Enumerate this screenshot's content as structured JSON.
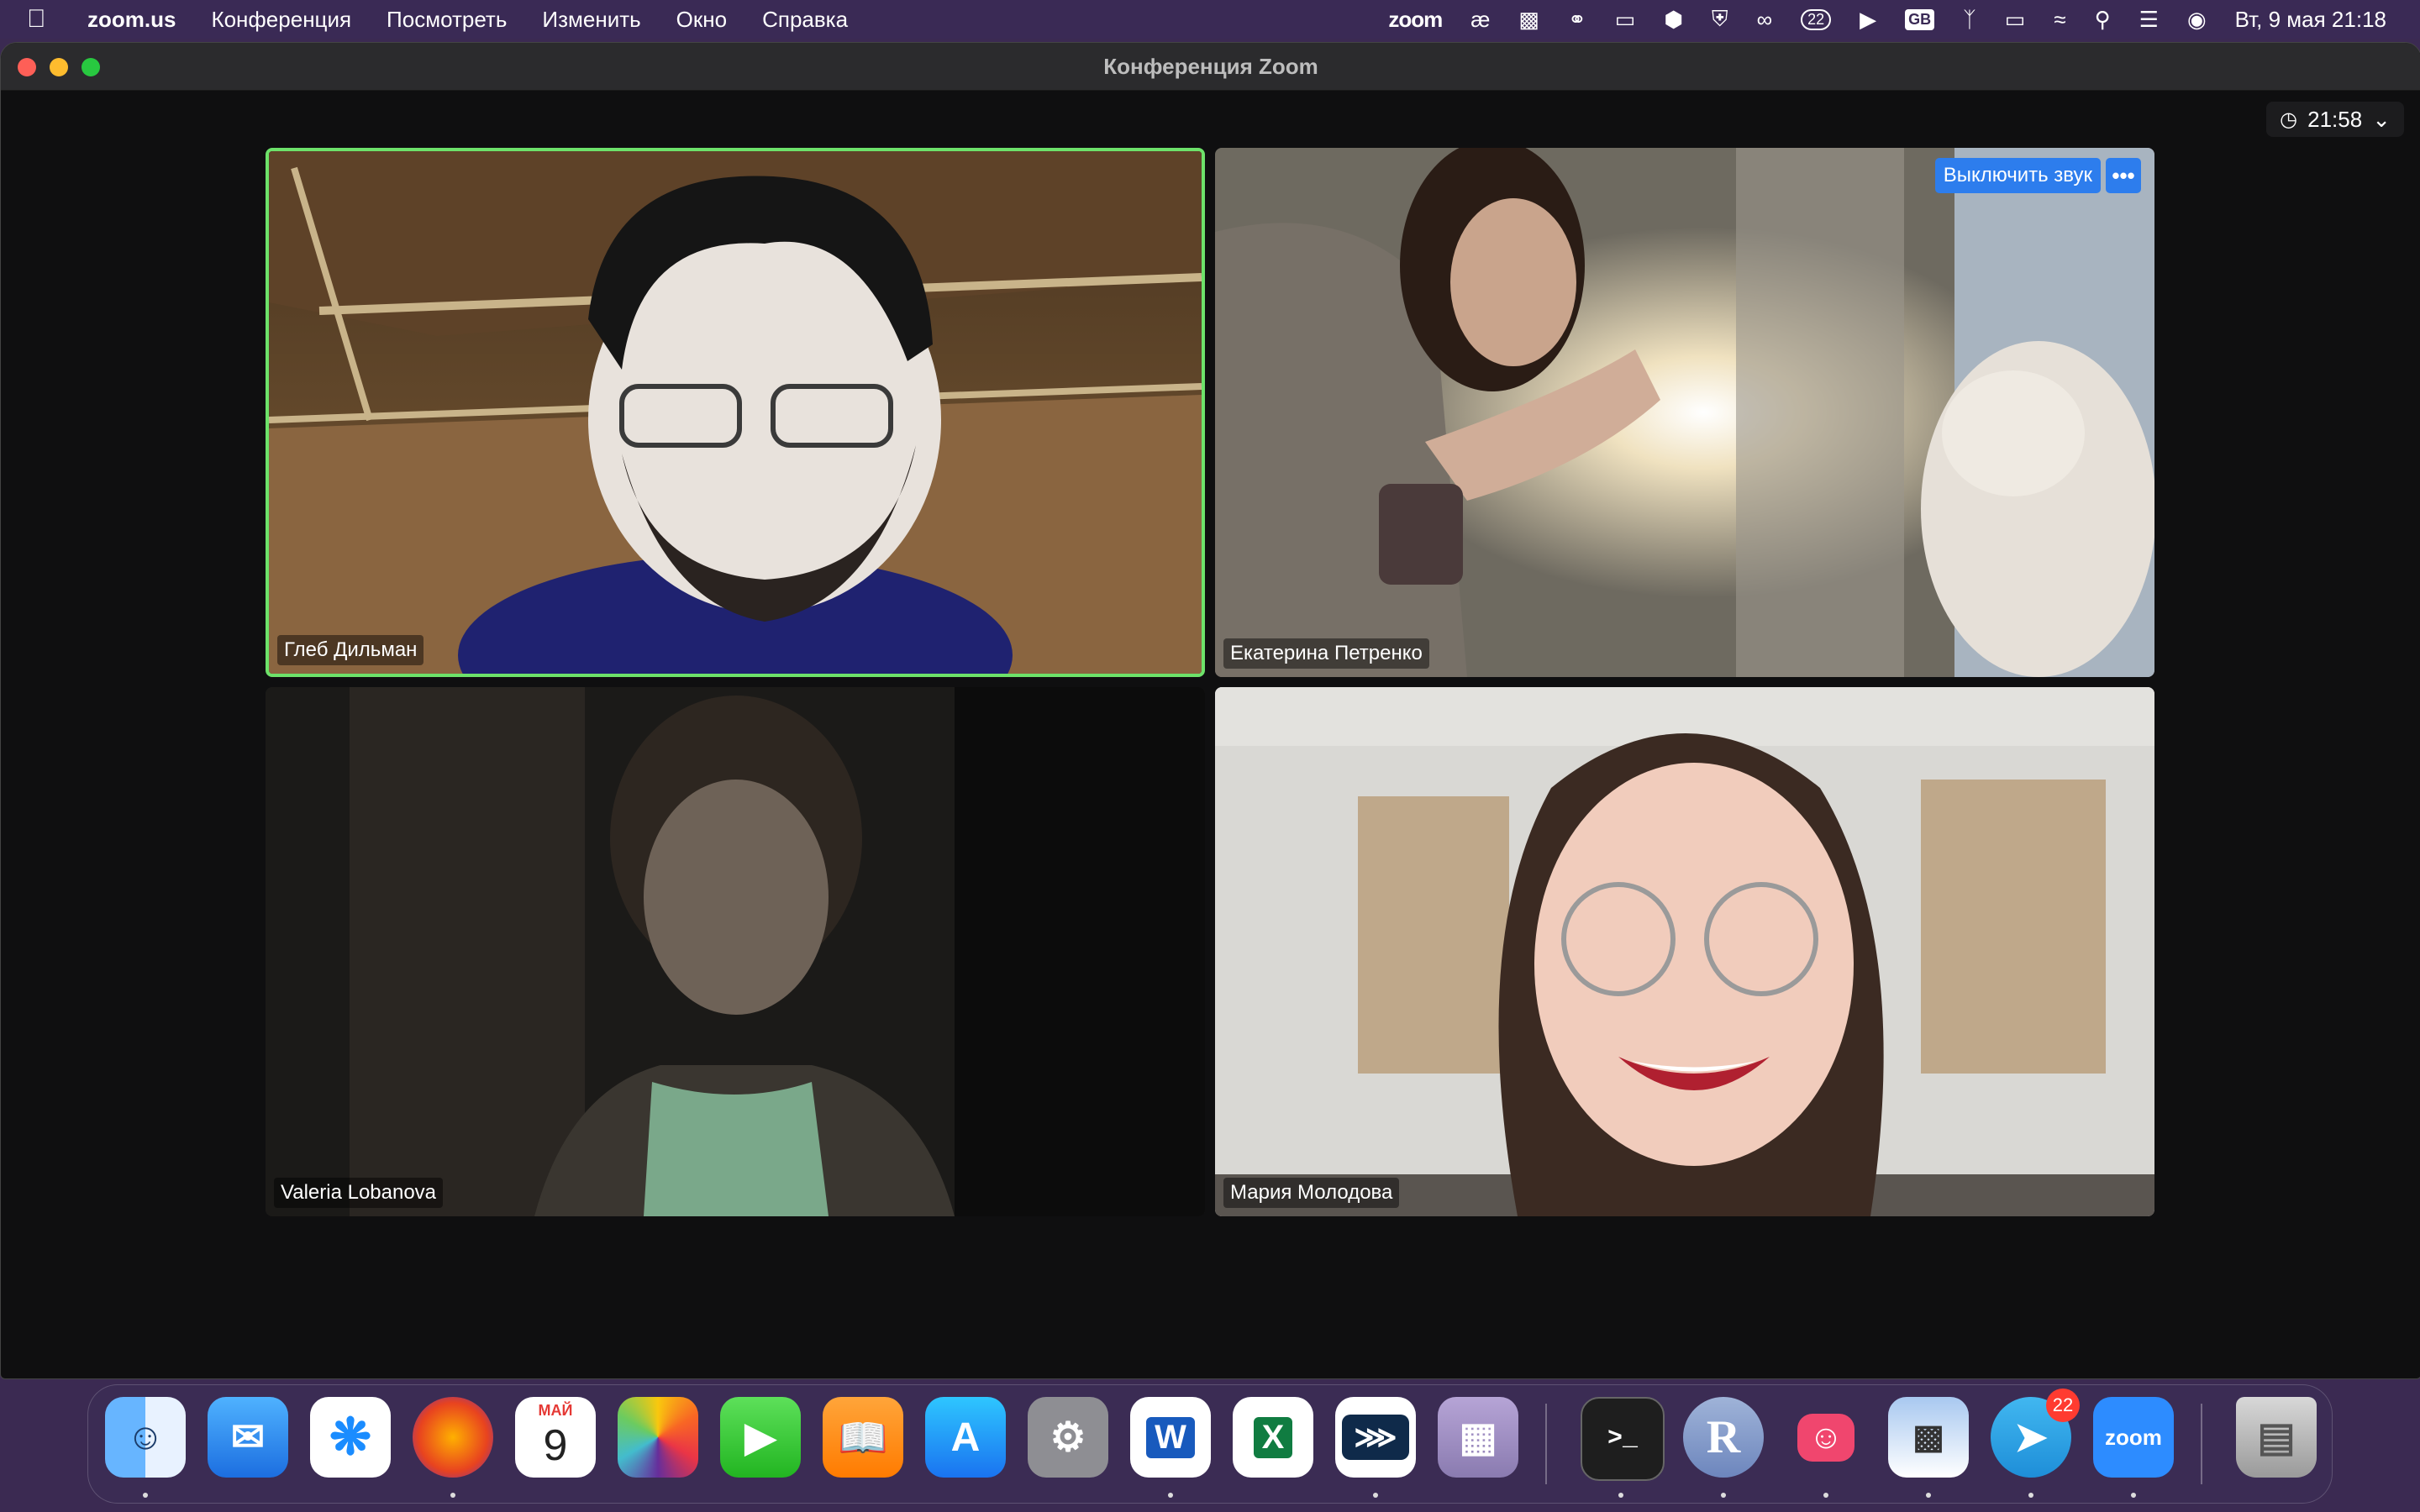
{
  "menubar": {
    "app_name": "zoom.us",
    "items": [
      "Конференция",
      "Посмотреть",
      "Изменить",
      "Окно",
      "Справка"
    ],
    "tray": {
      "zoom_label": "zoom",
      "ae_label": "æ",
      "notification_count": "22",
      "keyboard_layout": "GB",
      "datetime": "Вт, 9 мая  21:18"
    }
  },
  "window": {
    "title": "Конференция Zoom",
    "meeting_timer": "21:58"
  },
  "participants": [
    {
      "name": "Глеб Дильман",
      "active_speaker": true
    },
    {
      "name": "Екатерина Петренко",
      "mute_button": "Выключить звук",
      "more_button": "•••"
    },
    {
      "name": "Valeria Lobanova"
    },
    {
      "name": "Мария Молодова"
    }
  ],
  "dock": {
    "calendar_month": "МАЙ",
    "calendar_day": "9",
    "telegram_badge": "22",
    "zoom_label": "zoom",
    "r_label": "R",
    "apps": [
      "finder",
      "mail",
      "safari",
      "firefox",
      "calendar",
      "photos",
      "facetime",
      "books",
      "app-store",
      "system-preferences",
      "word",
      "excel",
      "sourcetree",
      "launchpad",
      "terminal",
      "r",
      "robot",
      "preview",
      "telegram",
      "zoom",
      "trash"
    ]
  },
  "colors": {
    "active_speaker_border": "#6de26a",
    "mute_button_bg": "#2d7ded",
    "window_bg": "#0f0f10"
  }
}
